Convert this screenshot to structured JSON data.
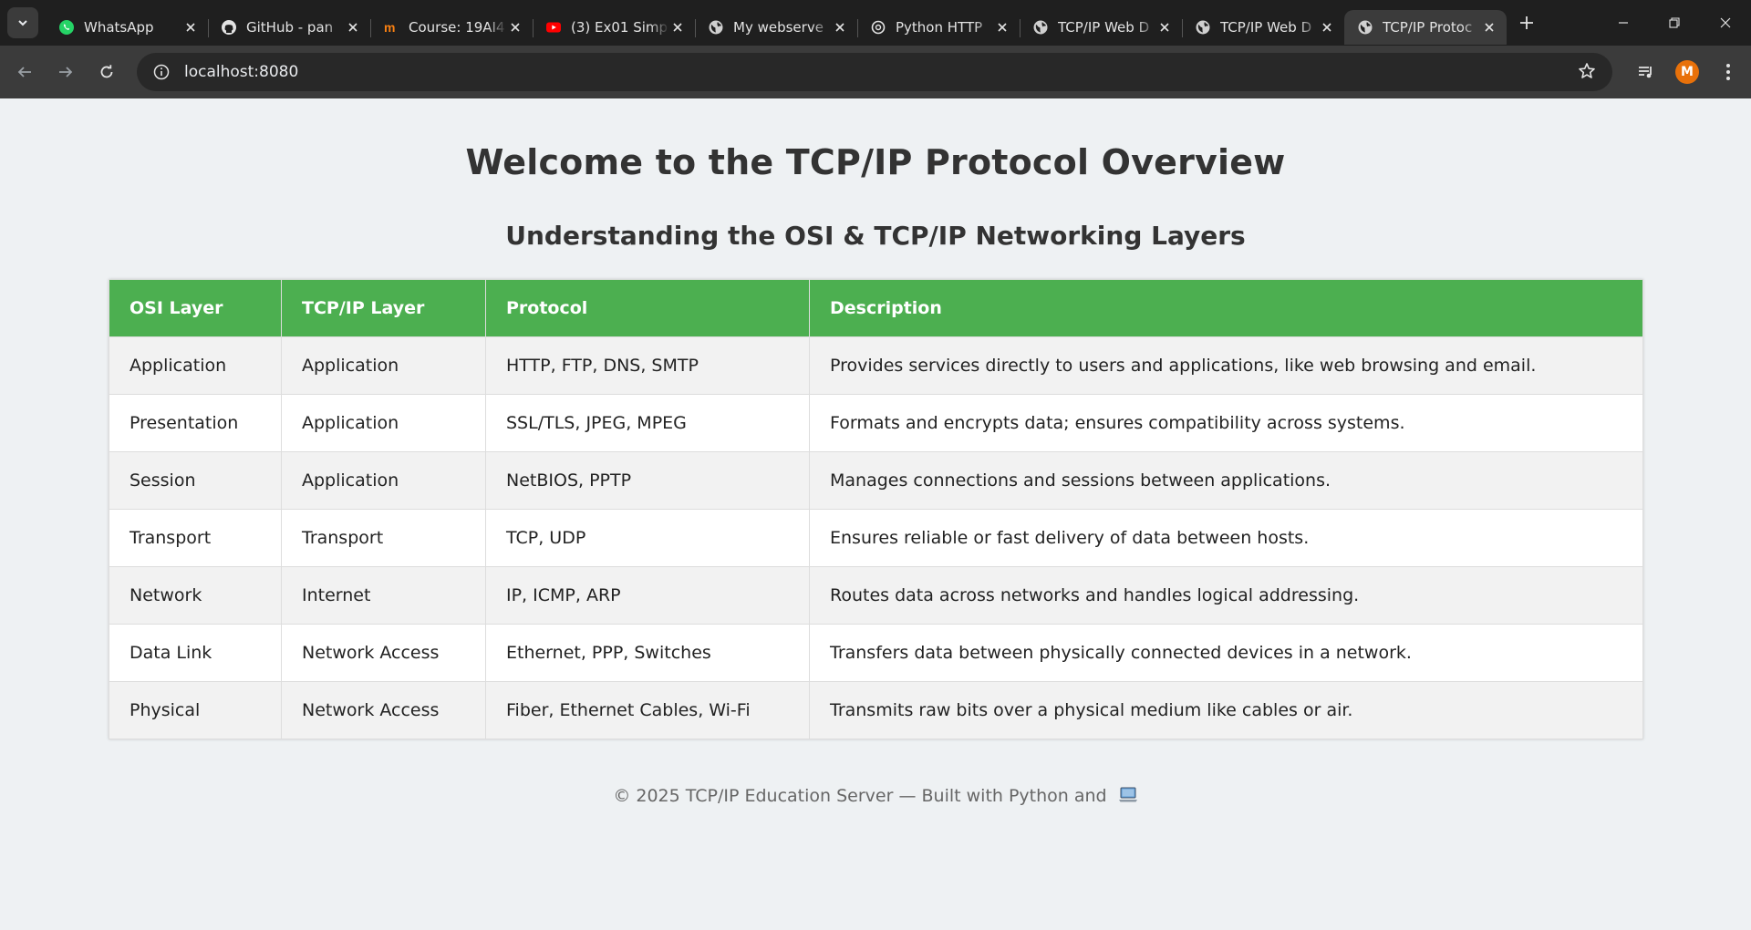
{
  "browser": {
    "tabs": [
      {
        "title": "WhatsApp",
        "icon": "whatsapp-icon"
      },
      {
        "title": "GitHub - pan",
        "icon": "github-icon"
      },
      {
        "title": "Course: 19AI4",
        "icon": "moodle-icon"
      },
      {
        "title": "(3) Ex01 Simp",
        "icon": "youtube-icon"
      },
      {
        "title": "My webserve",
        "icon": "globe-icon"
      },
      {
        "title": "Python HTTP",
        "icon": "chatgpt-icon"
      },
      {
        "title": "TCP/IP Web D",
        "icon": "globe-icon"
      },
      {
        "title": "TCP/IP Web D",
        "icon": "globe-icon"
      },
      {
        "title": "TCP/IP Protoc",
        "icon": "globe-icon",
        "active": true
      }
    ],
    "url": "localhost:8080",
    "avatar_initial": "M",
    "colors": {
      "tabbar": "#1f1f1f",
      "toolbar": "#3b3b3b",
      "omnibox": "#282828",
      "avatar": "#e8710a"
    }
  },
  "page": {
    "title": "Welcome to the TCP/IP Protocol Overview",
    "subtitle": "Understanding the OSI & TCP/IP Networking Layers",
    "table": {
      "headers": [
        "OSI Layer",
        "TCP/IP Layer",
        "Protocol",
        "Description"
      ],
      "rows": [
        [
          "Application",
          "Application",
          "HTTP, FTP, DNS, SMTP",
          "Provides services directly to users and applications, like web browsing and email."
        ],
        [
          "Presentation",
          "Application",
          "SSL/TLS, JPEG, MPEG",
          "Formats and encrypts data; ensures compatibility across systems."
        ],
        [
          "Session",
          "Application",
          "NetBIOS, PPTP",
          "Manages connections and sessions between applications."
        ],
        [
          "Transport",
          "Transport",
          "TCP, UDP",
          "Ensures reliable or fast delivery of data between hosts."
        ],
        [
          "Network",
          "Internet",
          "IP, ICMP, ARP",
          "Routes data across networks and handles logical addressing."
        ],
        [
          "Data Link",
          "Network Access",
          "Ethernet, PPP, Switches",
          "Transfers data between physically connected devices in a network."
        ],
        [
          "Physical",
          "Network Access",
          "Fiber, Ethernet Cables, Wi-Fi",
          "Transmits raw bits over a physical medium like cables or air."
        ]
      ]
    },
    "footer": "© 2025 TCP/IP Education Server — Built with Python and",
    "footer_icon": "laptop-icon",
    "colors": {
      "header_bg": "#4caf50",
      "page_bg": "#eef1f3",
      "stripe": "#f2f2f2"
    }
  }
}
